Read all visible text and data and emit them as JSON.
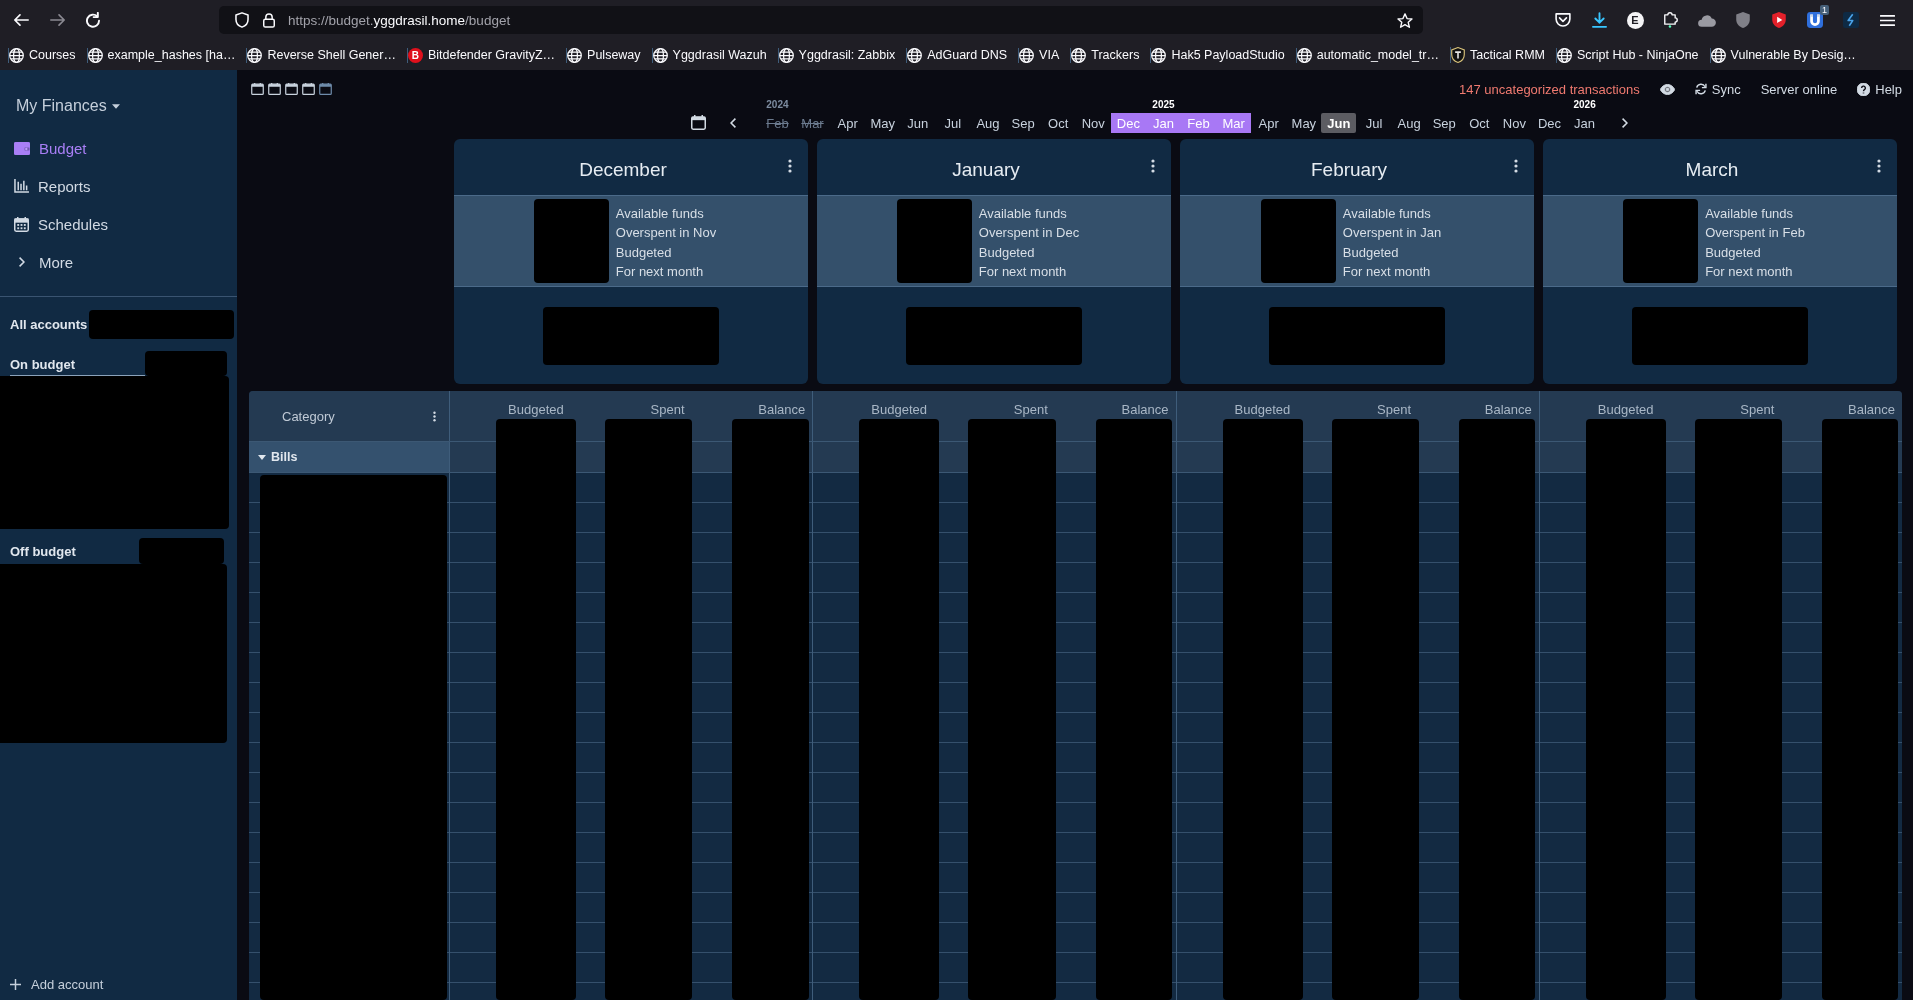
{
  "browser": {
    "nav_buttons": [
      {
        "kind": "back",
        "disabled": false
      },
      {
        "kind": "forward",
        "disabled": true
      },
      {
        "kind": "reload",
        "disabled": false
      }
    ],
    "address": {
      "prefix": "https://budget.",
      "domain": "yggdrasil.home",
      "path": "/budget"
    },
    "toolbar_icons": [
      {
        "kind": "pocket"
      },
      {
        "kind": "download"
      },
      {
        "kind": "letter",
        "label": "E"
      },
      {
        "kind": "puzzle"
      },
      {
        "kind": "cloud"
      },
      {
        "kind": "shield"
      },
      {
        "kind": "play"
      },
      {
        "kind": "magnet",
        "badge": "1"
      },
      {
        "kind": "bolt"
      },
      {
        "kind": "menu"
      }
    ],
    "bookmarks": [
      {
        "kind": "plain",
        "label": "Courses"
      },
      {
        "kind": "plain",
        "label": "example_hashes [ha…"
      },
      {
        "kind": "plain",
        "label": "Reverse Shell Gener…"
      },
      {
        "kind": "letter",
        "logo_text": "B",
        "label": "Bitdefender GravityZ…"
      },
      {
        "kind": "plain",
        "label": "Pulseway"
      },
      {
        "kind": "plain",
        "label": "Yggdrasil Wazuh"
      },
      {
        "kind": "plain",
        "label": "Yggdrasil: Zabbix"
      },
      {
        "kind": "plain",
        "label": "AdGuard DNS"
      },
      {
        "kind": "plain",
        "label": "VIA"
      },
      {
        "kind": "plain",
        "label": "Trackers"
      },
      {
        "kind": "plain",
        "label": "Hak5 PayloadStudio"
      },
      {
        "kind": "plain",
        "label": "automatic_model_tr…"
      },
      {
        "kind": "emblem",
        "label": "Tactical RMM"
      },
      {
        "kind": "plain",
        "label": "Script Hub - NinjaOne"
      },
      {
        "kind": "plain",
        "label": "Vulnerable By Desig…"
      }
    ]
  },
  "sidebar": {
    "budget_name": "My Finances",
    "nav": [
      {
        "label": "Budget",
        "selected": true
      },
      {
        "label": "Reports",
        "selected": false
      },
      {
        "label": "Schedules",
        "selected": false
      },
      {
        "label": "More",
        "selected": false
      }
    ],
    "accounts": [
      {
        "kind": "total",
        "label": "All accounts"
      },
      {
        "kind": "on_budget",
        "label": "On budget"
      },
      {
        "kind": "off_budget",
        "label": "Off budget"
      }
    ],
    "add_account": "Add account"
  },
  "header": {
    "month_counts": [
      {
        "on": true
      },
      {
        "on": true
      },
      {
        "on": true
      },
      {
        "on": true
      },
      {
        "on": false
      }
    ],
    "uncategorized": "147 uncategorized transactions",
    "sync": "Sync",
    "server_status": "Server online",
    "help": "Help"
  },
  "month_strip": {
    "months": [
      {
        "label": "Feb",
        "year": "2024",
        "disabled": true,
        "selected": false,
        "current": false
      },
      {
        "label": "Mar",
        "disabled": true,
        "selected": false,
        "current": false
      },
      {
        "label": "Apr",
        "disabled": false,
        "selected": false,
        "current": false
      },
      {
        "label": "May",
        "disabled": false,
        "selected": false,
        "current": false
      },
      {
        "label": "Jun",
        "disabled": false,
        "selected": false,
        "current": false
      },
      {
        "label": "Jul",
        "disabled": false,
        "selected": false,
        "current": false
      },
      {
        "label": "Aug",
        "disabled": false,
        "selected": false,
        "current": false
      },
      {
        "label": "Sep",
        "disabled": false,
        "selected": false,
        "current": false
      },
      {
        "label": "Oct",
        "disabled": false,
        "selected": false,
        "current": false
      },
      {
        "label": "Nov",
        "disabled": false,
        "selected": false,
        "current": false
      },
      {
        "label": "Dec",
        "disabled": false,
        "selected": true,
        "current": false
      },
      {
        "label": "Jan",
        "year": "2025",
        "disabled": false,
        "selected": true,
        "current": false
      },
      {
        "label": "Feb",
        "disabled": false,
        "selected": true,
        "current": false
      },
      {
        "label": "Mar",
        "disabled": false,
        "selected": true,
        "current": false
      },
      {
        "label": "Apr",
        "disabled": false,
        "selected": false,
        "current": false
      },
      {
        "label": "May",
        "disabled": false,
        "selected": false,
        "current": false
      },
      {
        "label": "Jun",
        "disabled": false,
        "selected": false,
        "current": true
      },
      {
        "label": "Jul",
        "disabled": false,
        "selected": false,
        "current": false
      },
      {
        "label": "Aug",
        "disabled": false,
        "selected": false,
        "current": false
      },
      {
        "label": "Sep",
        "disabled": false,
        "selected": false,
        "current": false
      },
      {
        "label": "Oct",
        "disabled": false,
        "selected": false,
        "current": false
      },
      {
        "label": "Nov",
        "disabled": false,
        "selected": false,
        "current": false
      },
      {
        "label": "Dec",
        "disabled": false,
        "selected": false,
        "current": false
      },
      {
        "label": "Jan",
        "year": "2026",
        "disabled": false,
        "selected": false,
        "current": false
      }
    ]
  },
  "month_cards": [
    {
      "title": "December",
      "summary": [
        "Available funds",
        "Overspent in Nov",
        "Budgeted",
        "For next month"
      ]
    },
    {
      "title": "January",
      "summary": [
        "Available funds",
        "Overspent in Dec",
        "Budgeted",
        "For next month"
      ]
    },
    {
      "title": "February",
      "summary": [
        "Available funds",
        "Overspent in Jan",
        "Budgeted",
        "For next month"
      ]
    },
    {
      "title": "March",
      "summary": [
        "Available funds",
        "Overspent in Feb",
        "Budgeted",
        "For next month"
      ]
    }
  ],
  "table": {
    "category_header": "Category",
    "month_columns": [
      {
        "headers": [
          "Budgeted",
          "Spent",
          "Balance"
        ]
      },
      {
        "headers": [
          "Budgeted",
          "Spent",
          "Balance"
        ]
      },
      {
        "headers": [
          "Budgeted",
          "Spent",
          "Balance"
        ]
      },
      {
        "headers": [
          "Budgeted",
          "Spent",
          "Balance"
        ]
      }
    ],
    "groups": [
      {
        "name": "Bills",
        "expanded": true
      }
    ]
  }
}
